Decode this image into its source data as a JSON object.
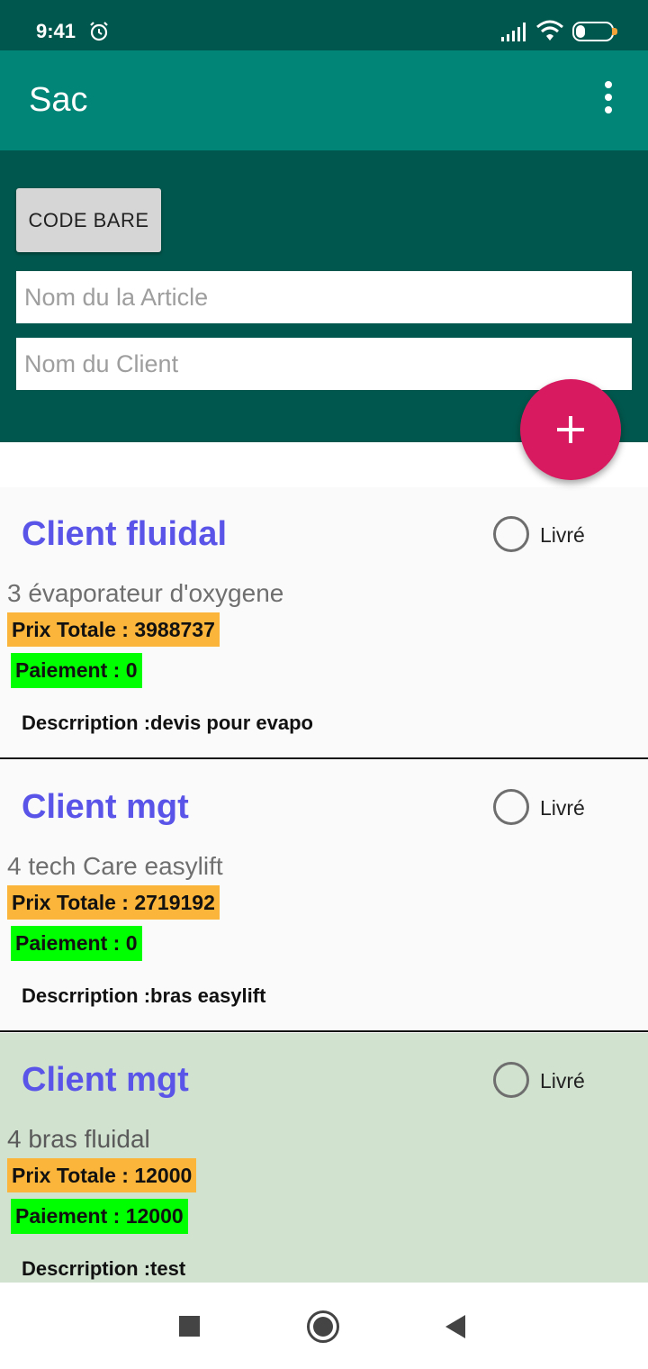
{
  "status_bar": {
    "time": "9:41",
    "battery": "27",
    "battery_level": 0.27,
    "icons": [
      "alarm-icon",
      "signal-icon",
      "wifi-icon",
      "battery-icon"
    ]
  },
  "app_bar": {
    "title": "Sac",
    "menu_icon": "overflow-menu-icon"
  },
  "form": {
    "barcode_label": "CODE BARE",
    "article_placeholder": "Nom du la Article",
    "client_placeholder": "Nom du Client",
    "fab_icon": "plus-icon"
  },
  "colors": {
    "status_bar": "#00574d",
    "app_bar": "#008577",
    "fab": "#d81b60",
    "client_name": "#5a55e8",
    "price_bg": "#fbb53a",
    "payment_bg": "#00ff00",
    "delivered_card_bg": "#d1e2cf"
  },
  "cards": [
    {
      "client": "Client fluidal",
      "status_label": "Livré",
      "article": "3 évaporateur d'oxygene",
      "price": "Prix Totale : 3988737",
      "payment": "Paiement  : 0",
      "description": "Descrription :devis pour evapo"
    },
    {
      "client": "Client mgt",
      "status_label": "Livré",
      "article": "4 tech Care easylift",
      "price": "Prix Totale : 2719192",
      "payment": "Paiement  : 0",
      "description": "Descrription :bras easylift"
    },
    {
      "client": "Client mgt",
      "status_label": "Livré",
      "article": "4 bras fluidal",
      "price": "Prix Totale : 12000",
      "payment": "Paiement  : 12000",
      "description": "Descrription :test"
    }
  ],
  "nav_bar": {
    "icons": [
      "recent-apps-icon",
      "home-icon",
      "back-icon"
    ]
  }
}
